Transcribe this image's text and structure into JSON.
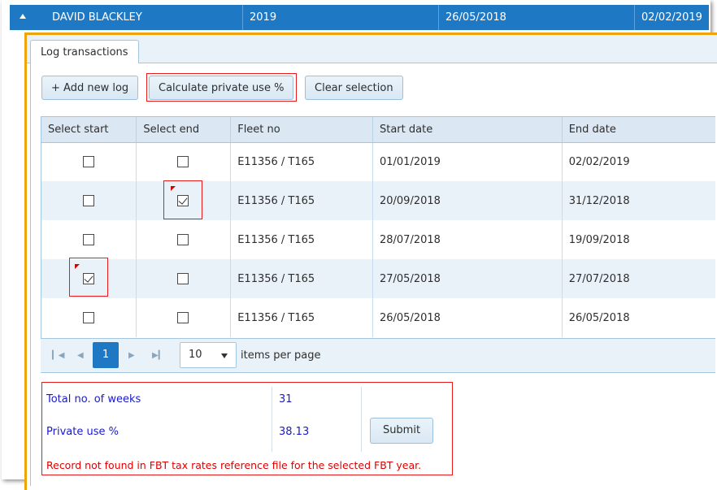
{
  "header": {
    "name": "DAVID BLACKLEY",
    "year": "2019",
    "date1": "26/05/2018",
    "date2": "02/02/2019"
  },
  "tabs": [
    {
      "label": "Log transactions"
    }
  ],
  "toolbar": {
    "add_label": "+ Add new log",
    "calc_label": "Calculate private use %",
    "clear_label": "Clear selection"
  },
  "grid": {
    "columns": [
      "Select start",
      "Select end",
      "Fleet no",
      "Start date",
      "End date"
    ],
    "rows": [
      {
        "start_checked": false,
        "end_checked": false,
        "fleet": "E11356 / T165",
        "start_date": "01/01/2019",
        "end_date": "02/02/2019"
      },
      {
        "start_checked": false,
        "end_checked": true,
        "fleet": "E11356 / T165",
        "start_date": "20/09/2018",
        "end_date": "31/12/2018"
      },
      {
        "start_checked": false,
        "end_checked": false,
        "fleet": "E11356 / T165",
        "start_date": "28/07/2018",
        "end_date": "19/09/2018"
      },
      {
        "start_checked": true,
        "end_checked": false,
        "fleet": "E11356 / T165",
        "start_date": "27/05/2018",
        "end_date": "27/07/2018"
      },
      {
        "start_checked": false,
        "end_checked": false,
        "fleet": "E11356 / T165",
        "start_date": "26/05/2018",
        "end_date": "26/05/2018"
      }
    ]
  },
  "pager": {
    "page": "1",
    "page_size": "10",
    "per_page_label": "items per page"
  },
  "summary": {
    "weeks_label": "Total no. of weeks",
    "weeks_value": "31",
    "private_label": "Private use %",
    "private_value": "38.13",
    "submit_label": "Submit",
    "error": "Record not found in FBT tax rates reference file for the selected FBT year."
  },
  "colors": {
    "accent": "#1f78c4",
    "container_border": "#f0a30a",
    "highlight": "#e81a1a",
    "summary_text": "#1a1acc"
  }
}
